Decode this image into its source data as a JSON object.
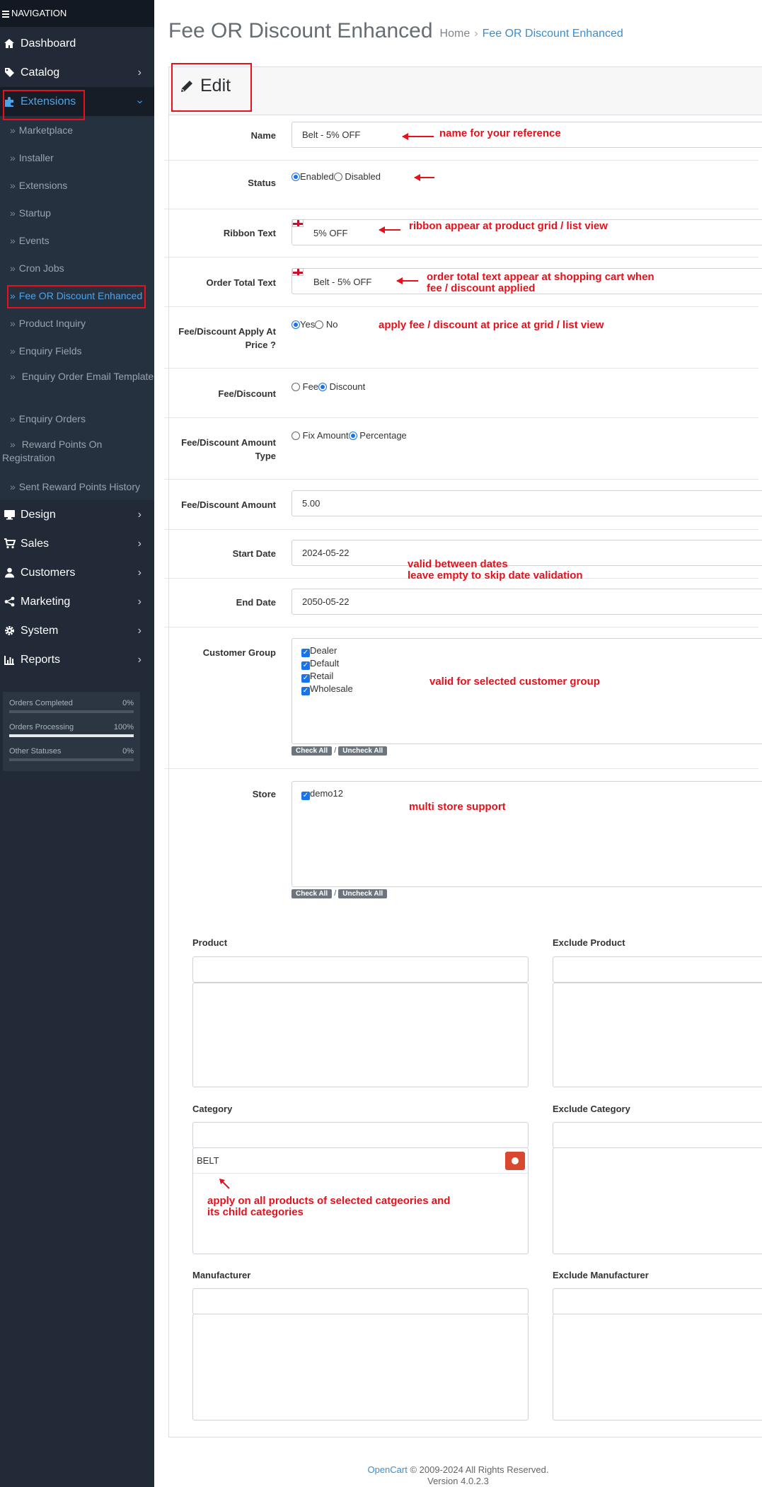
{
  "nav": {
    "header": "NAVIGATION",
    "items": [
      {
        "label": "Dashboard",
        "icon": "home-icon"
      },
      {
        "label": "Catalog",
        "icon": "tag-icon"
      },
      {
        "label": "Extensions",
        "icon": "puzzle-icon"
      },
      {
        "label": "Design",
        "icon": "monitor-icon"
      },
      {
        "label": "Sales",
        "icon": "cart-icon"
      },
      {
        "label": "Customers",
        "icon": "user-icon"
      },
      {
        "label": "Marketing",
        "icon": "share-icon"
      },
      {
        "label": "System",
        "icon": "gear-icon"
      },
      {
        "label": "Reports",
        "icon": "chart-icon"
      }
    ],
    "sub_items": [
      "Marketplace",
      "Installer",
      "Extensions",
      "Startup",
      "Events",
      "Cron Jobs",
      "Fee OR Discount Enhanced",
      "Product Inquiry",
      "Enquiry Fields",
      "Enquiry Order Email Template",
      "Enquiry Orders",
      "Reward Points On Registration",
      "Sent Reward Points History"
    ],
    "stats": [
      {
        "label": "Orders Completed",
        "value": "0%",
        "fraction": 0
      },
      {
        "label": "Orders Processing",
        "value": "100%",
        "fraction": 1
      },
      {
        "label": "Other Statuses",
        "value": "0%",
        "fraction": 0
      }
    ]
  },
  "page": {
    "title": "Fee OR Discount Enhanced",
    "breadcrumb_home": "Home",
    "breadcrumb_current": "Fee OR Discount Enhanced",
    "edit_title": "Edit"
  },
  "form": {
    "name_label": "Name",
    "name_value": "Belt - 5% OFF",
    "status_label": "Status",
    "status_enabled": "Enabled",
    "status_disabled": "Disabled",
    "ribbon_label": "Ribbon Text",
    "ribbon_value": "5% OFF",
    "order_total_label": "Order Total Text",
    "order_total_value": "Belt - 5% OFF",
    "apply_price_label": "Fee/Discount Apply At Price ?",
    "apply_yes": "Yes",
    "apply_no": "No",
    "fee_discount_label": "Fee/Discount",
    "fee_option": "Fee",
    "discount_option": "Discount",
    "amount_type_label": "Fee/Discount Amount Type",
    "fix_amount": "Fix Amount",
    "percentage": "Percentage",
    "amount_label": "Fee/Discount Amount",
    "amount_value": "5.00",
    "start_label": "Start Date",
    "start_value": "2024-05-22",
    "end_label": "End Date",
    "end_value": "2050-05-22",
    "customer_group_label": "Customer Group",
    "customer_groups": [
      "Dealer",
      "Default",
      "Retail",
      "Wholesale"
    ],
    "store_label": "Store",
    "stores": [
      "demo12"
    ],
    "check_all": "Check All",
    "uncheck_all": "Uncheck All",
    "product_label": "Product",
    "exclude_product_label": "Exclude Product",
    "category_label": "Category",
    "exclude_category_label": "Exclude Category",
    "category_chip": "BELT",
    "manufacturer_label": "Manufacturer",
    "exclude_manufacturer_label": "Exclude Manufacturer"
  },
  "annotations": {
    "name": "name for your reference",
    "ribbon": "ribbon appear at product grid / list view",
    "order_total_1": "order total text appear at shopping cart when",
    "order_total_2": "fee / discount applied",
    "apply_price": "apply fee / discount at price at grid / list view",
    "dates_1": "valid between dates",
    "dates_2": "leave empty to skip date validation",
    "customer_group": "valid for selected customer group",
    "store": "multi store support",
    "category_1": "apply on all products of selected catgeories and",
    "category_2": "its child categories"
  },
  "footer": {
    "link": "OpenCart",
    "copyright": "© 2009-2024 All Rights Reserved.",
    "version": "Version 4.0.2.3"
  },
  "colors": {
    "sidebar": "#212a36",
    "accent": "#4da3e8",
    "annotation": "#e8101b"
  }
}
